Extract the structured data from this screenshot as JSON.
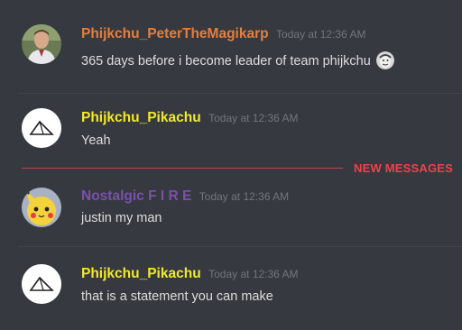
{
  "messages": [
    {
      "author": "Phijkchu_PeterTheMagikarp",
      "author_color": "#e67e3c",
      "timestamp": "Today at 12:36 AM",
      "text": "365 days before i become leader of team phijkchu",
      "avatar": "photo-avatar",
      "has_emoji": true,
      "emoji": "face-emoji"
    },
    {
      "author": "Phijkchu_Pikachu",
      "author_color": "#f1e92b",
      "timestamp": "Today at 12:36 AM",
      "text": "Yeah",
      "avatar": "triangle-logo-avatar"
    },
    {
      "author": "Nostalgic F I R E",
      "author_color": "#7c4fb0",
      "timestamp": "Today at 12:36 AM",
      "text": "justin my man",
      "avatar": "pikachu-avatar"
    },
    {
      "author": "Phijkchu_Pikachu",
      "author_color": "#f1e92b",
      "timestamp": "Today at 12:36 AM",
      "text": "that is a statement you can make",
      "avatar": "triangle-logo-avatar"
    }
  ],
  "new_messages_label": "NEW MESSAGES",
  "colors": {
    "background": "#36393f",
    "new_messages": "#e8454b",
    "timestamp": "#72767d"
  }
}
